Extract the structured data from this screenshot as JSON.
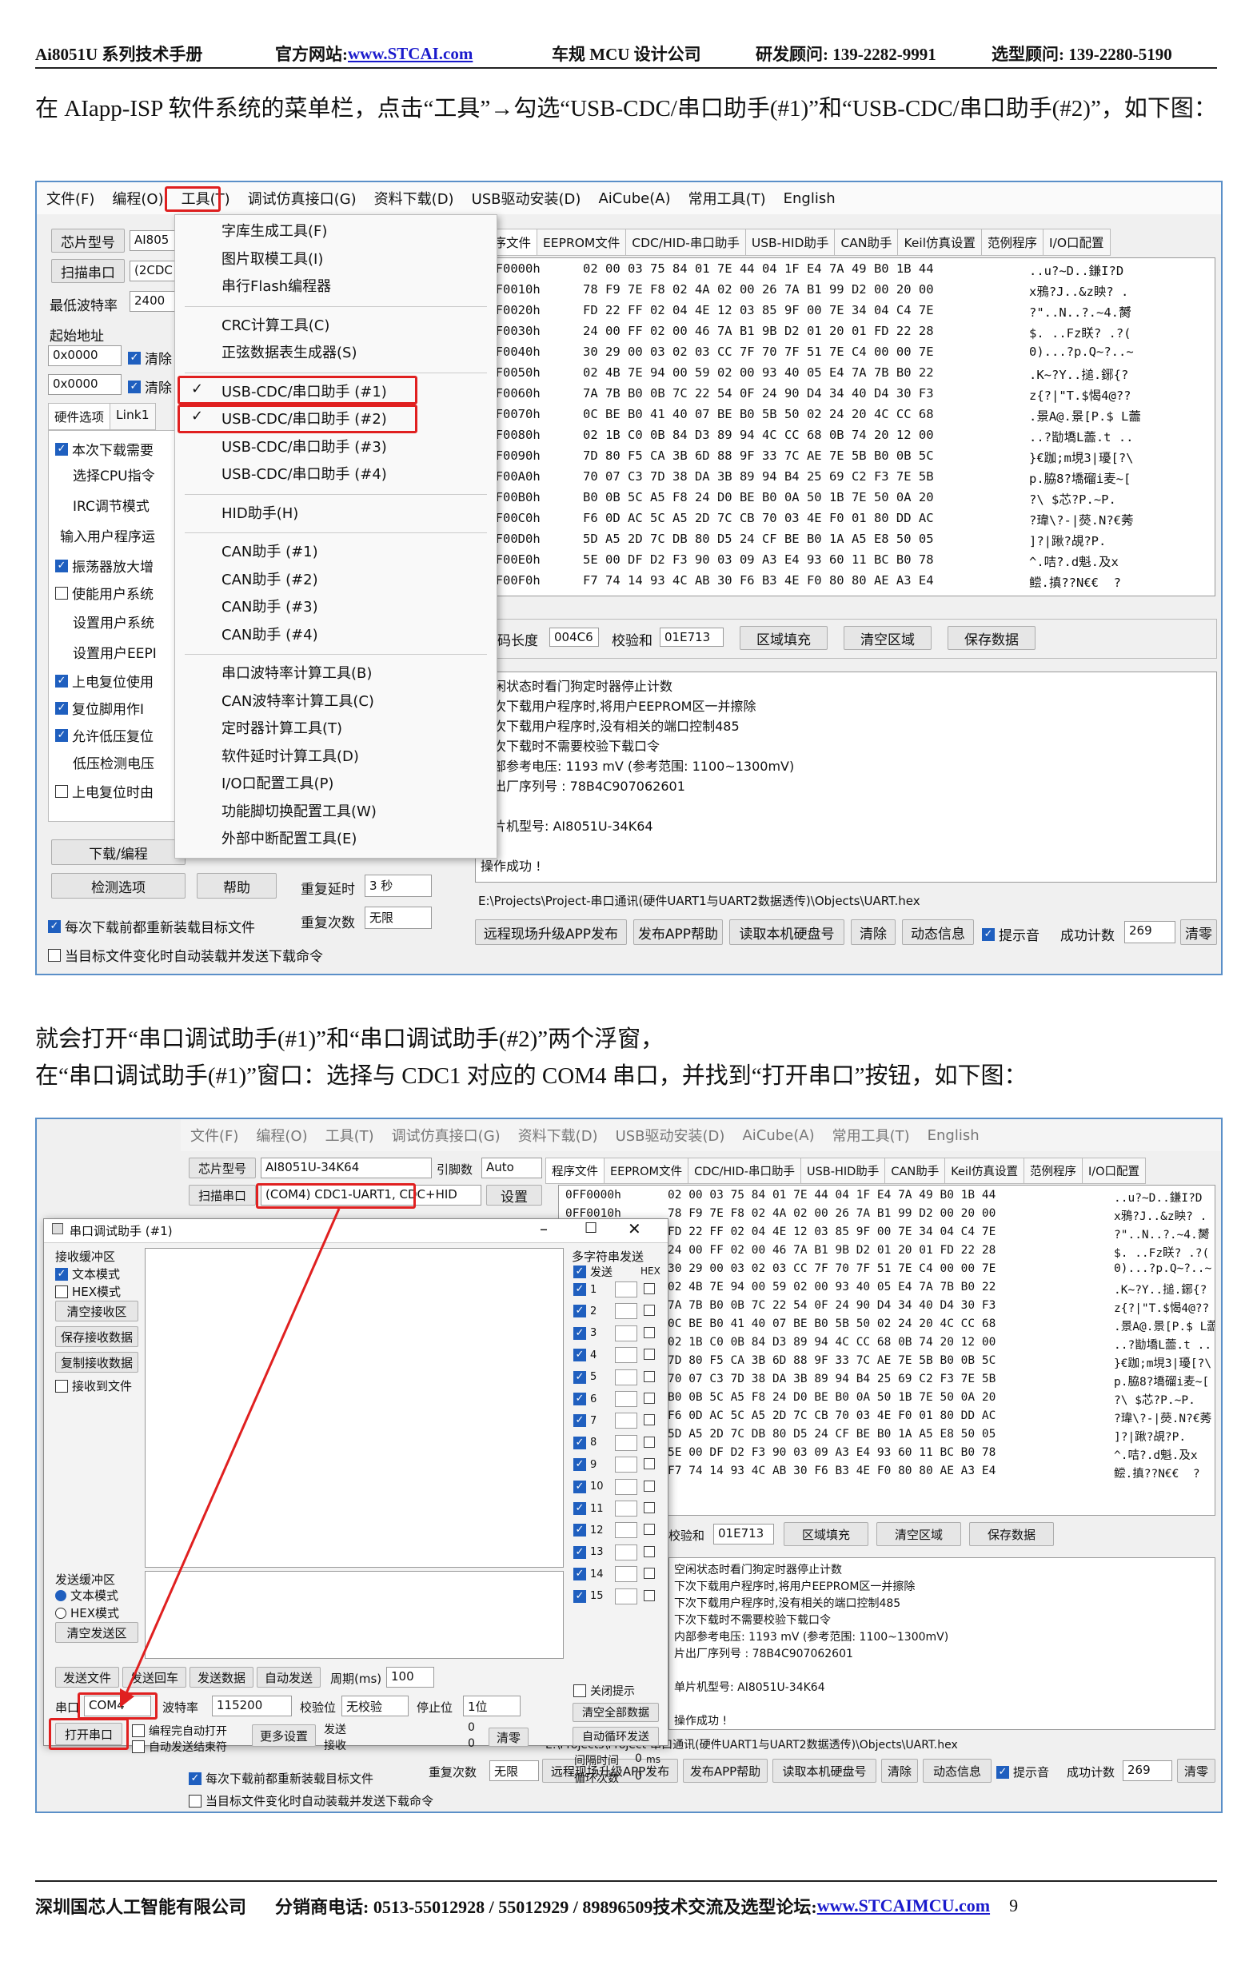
{
  "header": {
    "title": "Ai8051U 系列技术手册",
    "website_label": "官方网站:",
    "website_url": "www.STCAI.com",
    "company": "车规 MCU 设计公司",
    "rd": "研发顾问: 139-2282-9991",
    "sel": "选型顾问: 139-2280-5190"
  },
  "para1": "在 AIapp-ISP 软件系统的菜单栏，点击“工具”→勾选“USB-CDC/串口助手(#1)”和“USB-CDC/串口助手(#2)”，如下图：",
  "para2_line1": "就会打开“串口调试助手(#1)”和“串口调试助手(#2)”两个浮窗，",
  "para2_line2": "在“串口调试助手(#1)”窗口：选择与 CDC1 对应的 COM4 串口，并找到“打开串口”按钮，如下图：",
  "app": {
    "menu": [
      "文件(F)",
      "编程(O)",
      "工具(T)",
      "调试仿真接口(G)",
      "资料下载(D)",
      "USB驱动安装(D)",
      "AiCube(A)",
      "常用工具(T)",
      "English"
    ],
    "tabs": [
      "程序文件",
      "EEPROM文件",
      "CDC/HID-串口助手",
      "USB-HID助手",
      "CAN助手",
      "Keil仿真设置",
      "范例程序",
      "I/O口配置"
    ],
    "chip_btn": "芯片型号",
    "chip_val": "AI8051U-34K64",
    "chip_short": "AI805",
    "scan_btn": "扫描串口",
    "port_val": "(COM4) CDC1-UART1, CDC+HID",
    "port_short": "(2CDC",
    "baud_label": "最低波特率",
    "baud_val": "2400",
    "start_addr": "起始地址",
    "addr1": "0x0000",
    "addr2": "0x0000",
    "clear": "清除",
    "ref_label": "引脚数",
    "ref_val": "Auto",
    "settings": "设置",
    "hw_tabs": [
      "硬件选项",
      "Link1"
    ],
    "options": [
      "本次下载需要",
      "选择CPU指令",
      "IRC调节模式",
      "输入用户程序运",
      "振荡器放大增",
      "使能用户系统",
      "设置用户系统",
      "设置用户EEPI",
      "上电复位使用",
      "复位脚用作I",
      "允许低压复位",
      "低压检测电压",
      "上电复位时由"
    ],
    "download_btn": "下载/编程",
    "check_btn": "检测选项",
    "help_btn": "帮助",
    "retry_delay_label": "重复延时",
    "retry_delay_val": "3 秒",
    "retry_count_label": "重复次数",
    "retry_count_val": "无限",
    "reload_chk": "每次下载前都重新装载目标文件",
    "auto_chk": "当目标文件变化时自动装载并发送下载命令",
    "code_len_label": "代码长度",
    "code_len_val": "004C6",
    "checksum_label": "校验和",
    "checksum_val": "01E713",
    "fill_btn": "区域填充",
    "clear_area_btn": "清空区域",
    "save_btn": "保存数据",
    "hex_rows": [
      {
        "addr": "0FF0000h",
        "bytes": "02 00 03 75 84 01 7E 44 04 1F E4 7A 49 B0 1B 44",
        "ascii": "..u?~D..鎌I?D"
      },
      {
        "addr": "0FF0010h",
        "bytes": "78 F9 7E F8 02 4A 02 00 26 7A B1 99 D2 00 20 00",
        "ascii": "x鴉?J..&z眏? ."
      },
      {
        "addr": "0FF0020h",
        "bytes": "FD 22 FF 02 04 4E 12 03 85 9F 00 7E 34 04 C4 7E",
        "ascii": "?\"..N..?.~4.膥"
      },
      {
        "addr": "0FF0030h",
        "bytes": "24 00 FF 02 00 46 7A B1 9B D2 01 20 01 FD 22 28",
        "ascii": "$. ..Fz眹? .?("
      },
      {
        "addr": "0FF0040h",
        "bytes": "30 29 00 03 02 03 CC 7F 70 7F 51 7E C4 00 00 7E",
        "ascii": "0)...?p.Q~?..~"
      },
      {
        "addr": "0FF0050h",
        "bytes": "02 4B 7E 94 00 59 02 00 93 40 05 E4 7A 7B B0 22",
        "ascii": ".K~?Y..搥.鋣{?"
      },
      {
        "addr": "0FF0060h",
        "bytes": "7A 7B B0 0B 7C 22 54 0F 24 90 D4 34 40 D4 30 F3",
        "ascii": "z{?|\"T.$愒4@??"
      },
      {
        "addr": "0FF0070h",
        "bytes": "0C BE B0 41 40 07 BE B0 5B 50 02 24 20 4C CC 68",
        "ascii": ".景A@.景[P.$ L蘦"
      },
      {
        "addr": "0FF0080h",
        "bytes": "02 1B C0 0B 84 D3 89 94 4C CC 68 0B 74 20 12 00",
        "ascii": "..?勓墧L蘦.t .."
      },
      {
        "addr": "0FF0090h",
        "bytes": "7D 80 F5 CA 3B 6D 88 9F 33 7C AE 7E 5B B0 0B 5C",
        "ascii": "}€跏;m垷3|瓇[?\\"
      },
      {
        "addr": "0FF00A0h",
        "bytes": "70 07 C3 7D 38 DA 3B 89 94 B4 25 69 C2 F3 7E 5B",
        "ascii": "p.脇8?墧磂i麦~["
      },
      {
        "addr": "0FF00B0h",
        "bytes": "B0 0B 5C A5 F8 24 D0 BE B0 0A 50 1B 7E 50 0A 20",
        "ascii": "?\\ $芯?P.~P. "
      },
      {
        "addr": "0FF00C0h",
        "bytes": "F6 0D AC 5C A5 2D 7C CB 70 03 4E F0 01 80 DD AC",
        "ascii": "?瑋\\?-|藀.N?€莠"
      },
      {
        "addr": "0FF00D0h",
        "bytes": "5D A5 2D 7C DB 80 D5 24 CF BE B0 1A A5 E8 50 05",
        "ascii": "]?|踿?覘?P."
      },
      {
        "addr": "0FF00E0h",
        "bytes": "5E 00 DF D2 F3 90 03 09 A3 E4 93 60 11 BC B0 78",
        "ascii": "^.咭?.d魁.及x"
      },
      {
        "addr": "0FF00F0h",
        "bytes": "F7 74 14 93 4C AB 30 F6 B3 4E F0 80 80 AE A3 E4",
        "ascii": "鲿.搷??N€€  ?"
      }
    ],
    "log_lines": [
      "空闲状态时看门狗定时器停止计数",
      "下次下载用户程序时,将用户EEPROM区一并擦除",
      "下次下载用户程序时,没有相关的端口控制485",
      "下次下载时不需要校验下载口令",
      "内部参考电压: 1193 mV (参考范围: 1100~1300mV)",
      "片出厂序列号 : 78B4C907062601",
      "",
      "单片机型号: AI8051U-34K64",
      "",
      "操作成功 !"
    ],
    "filepath": "E:\\Projects\\Project-串口通讯(硬件UART1与UART2数据透传)\\Objects\\UART.hex",
    "bottom_btns": [
      "远程现场升级APP发布",
      "发布APP帮助",
      "读取本机硬盘号",
      "清除",
      "动态信息"
    ],
    "beep_chk": "提示音",
    "count_label": "成功计数",
    "count_val": "269",
    "clear_zero": "清零"
  },
  "tools_menu": {
    "items_group1": [
      "字库生成工具(F)",
      "图片取模工具(I)",
      "串行Flash编程器"
    ],
    "items_group2": [
      "CRC计算工具(C)",
      "正弦数据表生成器(S)"
    ],
    "items_group3": [
      "USB-CDC/串口助手 (#1)",
      "USB-CDC/串口助手 (#2)",
      "USB-CDC/串口助手 (#3)",
      "USB-CDC/串口助手 (#4)"
    ],
    "items_group4": [
      "HID助手(H)"
    ],
    "items_group5": [
      "CAN助手 (#1)",
      "CAN助手 (#2)",
      "CAN助手 (#3)",
      "CAN助手 (#4)"
    ],
    "items_group6": [
      "串口波特率计算工具(B)",
      "CAN波特率计算工具(C)",
      "定时器计算工具(T)",
      "软件延时计算工具(D)",
      "I/O口配置工具(P)",
      "功能脚切换配置工具(W)",
      "外部中断配置工具(E)"
    ]
  },
  "serial_window": {
    "title": "串口调试助手 (#1)",
    "recv_group": "接收缓冲区",
    "text_mode": "文本模式",
    "hex_mode": "HEX模式",
    "clear_recv": "清空接收区",
    "save_recv": "保存接收数据",
    "copy_recv": "复制接收数据",
    "recv_file": "接收到文件",
    "send_group": "发送缓冲区",
    "clear_send": "清空发送区",
    "send_file": "发送文件",
    "send_cr": "发送回车",
    "send_data": "发送数据",
    "auto_send": "自动发送",
    "period_label": "周期(ms)",
    "period_val": "100",
    "port_label": "串口",
    "port_val": "COM4",
    "baud_label": "波特率",
    "baud_val": "115200",
    "parity_label": "校验位",
    "parity_val": "无校验",
    "stop_label": "停止位",
    "stop_val": "1位",
    "open_btn": "打开串口",
    "auto_open": "编程完自动打开",
    "auto_end": "自动发送结束符",
    "more_btn": "更多设置",
    "send_count_label": "发送",
    "send_count": "0",
    "recv_count_label": "接收",
    "recv_count": "0",
    "clear_btn": "清零",
    "multi_label": "多字符串发送",
    "send_col": "发送",
    "hex_col": "HEX",
    "rows": [
      "1",
      "2",
      "3",
      "4",
      "5",
      "6",
      "7",
      "8",
      "9",
      "10",
      "11",
      "12",
      "13",
      "14",
      "15"
    ],
    "close_prompt": "关闭提示",
    "clear_all": "清空全部数据",
    "auto_loop": "自动循环发送",
    "interval_label": "间隔时间",
    "interval_val": "0",
    "interval_unit": "ms",
    "loop_label": "循环次数",
    "loop_val": "0"
  },
  "footer": {
    "company": "深圳国芯人工智能有限公司",
    "phone": "分销商电话: 0513-55012928 / 55012929 / 89896509技术交流及选型论坛:",
    "forum": "www.STCAIMCU.com",
    "page": "9"
  }
}
